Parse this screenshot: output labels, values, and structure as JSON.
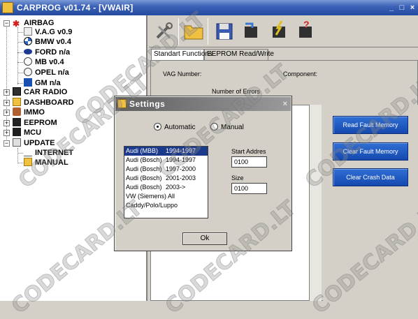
{
  "window": {
    "title": "CARPROG   v01.74 - [VWAIR]",
    "controls": [
      "_",
      "□",
      "×"
    ]
  },
  "tree": {
    "items": [
      {
        "label": "AIRBAG",
        "icon": "airbag-icon"
      },
      {
        "label": "V.A.G v0.9",
        "icon": "vag-logo-icon"
      },
      {
        "label": "BMW v0.4",
        "icon": "bmw-logo-icon"
      },
      {
        "label": "FORD n/a",
        "icon": "ford-logo-icon"
      },
      {
        "label": "MB v0.4",
        "icon": "mercedes-logo-icon"
      },
      {
        "label": "OPEL n/a",
        "icon": "opel-logo-icon"
      },
      {
        "label": "GM n/a",
        "icon": "gm-logo-icon"
      },
      {
        "label": "CAR RADIO",
        "icon": "radio-icon"
      },
      {
        "label": "DASHBOARD",
        "icon": "folder-icon"
      },
      {
        "label": "IMMO",
        "icon": "immo-icon"
      },
      {
        "label": "EEPROM",
        "icon": "chip-icon"
      },
      {
        "label": "MCU",
        "icon": "chip-icon"
      },
      {
        "label": "UPDATE",
        "icon": "update-icon"
      },
      {
        "label": "INTERNET",
        "icon": "internet-icon"
      },
      {
        "label": "MANUAL",
        "icon": "folder-icon"
      }
    ]
  },
  "toolbar": {
    "buttons": [
      {
        "name": "tools-icon",
        "color": "#7a7a7a"
      },
      {
        "name": "open-folder-icon",
        "color": "#f0c040"
      },
      {
        "name": "save-disk-icon",
        "color": "#3a5bb0"
      },
      {
        "name": "read-chip-icon",
        "color": "#4a8a4a"
      },
      {
        "name": "write-chip-icon",
        "color": "#c8a020"
      },
      {
        "name": "help-chip-icon",
        "color": "#c03030"
      }
    ]
  },
  "tabs": [
    {
      "label": "Standart Functions",
      "active": true
    },
    {
      "label": "EEPROM Read/Write",
      "active": false
    }
  ],
  "panel": {
    "vag_number_label": "VAG Number:",
    "component_label": "Component:",
    "errors_label": "Number of Errors"
  },
  "actions": {
    "read_fault": "Read Fault Memory",
    "clear_fault": "Clear Fault Memory",
    "clear_crash": "Clear Crash Data"
  },
  "dialog": {
    "title": "Settings",
    "close": "×",
    "mode_auto": "Automatic",
    "mode_manual": "Manual",
    "mode_selected": "Automatic",
    "list": [
      {
        "make": "Audi (MBB)",
        "years": "1994-1997",
        "selected": true
      },
      {
        "make": "Audi (Bosch)",
        "years": "1994-1997",
        "selected": false
      },
      {
        "make": "Audi (Bosch)",
        "years": "1997-2000",
        "selected": false
      },
      {
        "make": "Audi (Bosch)",
        "years": "2001-2003",
        "selected": false
      },
      {
        "make": "Audi (Bosch)",
        "years": "2003->",
        "selected": false
      },
      {
        "make": "VW (Siemens)",
        "years": "All",
        "selected": false
      },
      {
        "make": "Caddy/Polo/Luppo",
        "years": "",
        "selected": false
      }
    ],
    "start_address_label": "Start Addres",
    "start_address_value": "0100",
    "size_label": "Size",
    "size_value": "0100",
    "ok_label": "Ok"
  },
  "watermark": "CODECARD.LT",
  "colors": {
    "titlebar": "#234a9f",
    "action_button": "#1549b0",
    "list_selection": "#1c3a8c"
  }
}
